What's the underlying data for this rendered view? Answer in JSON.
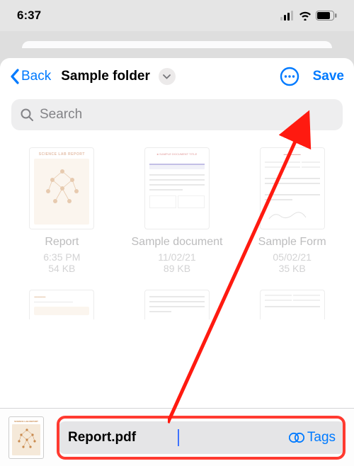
{
  "status": {
    "time": "6:37"
  },
  "nav": {
    "back_label": "Back",
    "folder_title": "Sample folder",
    "save_label": "Save"
  },
  "search": {
    "placeholder": "Search"
  },
  "files": [
    {
      "name": "Report",
      "date": "6:35 PM",
      "size": "54 KB"
    },
    {
      "name": "Sample document",
      "date": "11/02/21",
      "size": "89 KB"
    },
    {
      "name": "Sample Form",
      "date": "05/02/21",
      "size": "35 KB"
    }
  ],
  "filename_input": {
    "value": "Report.pdf"
  },
  "tags_label": "Tags",
  "colors": {
    "accent": "#007aff",
    "highlight": "#ff3a30"
  }
}
